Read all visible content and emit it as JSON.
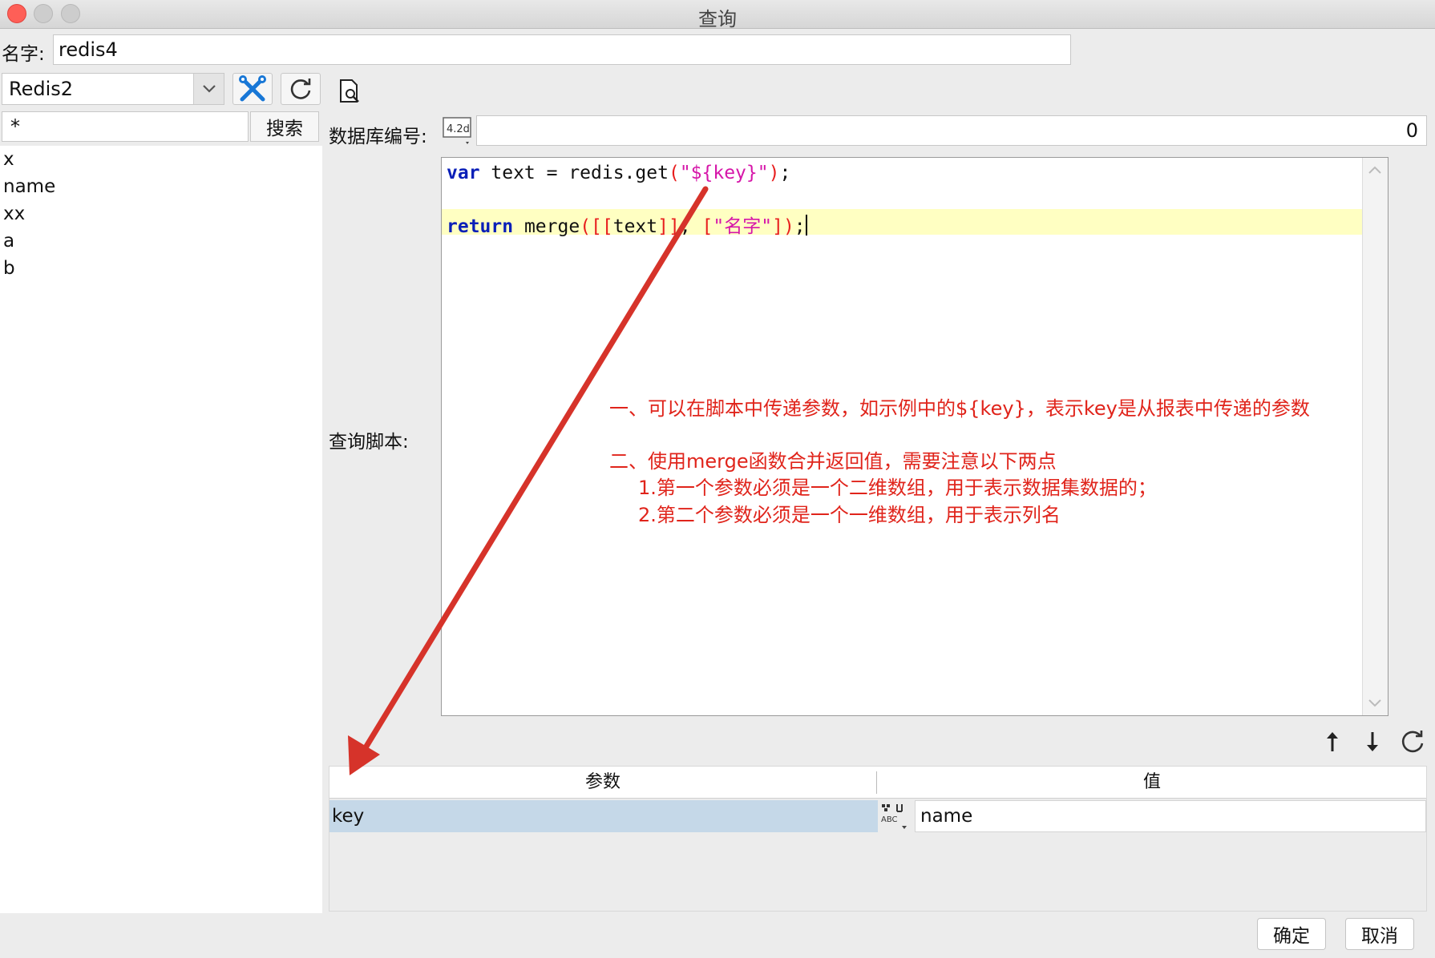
{
  "window": {
    "title": "查询",
    "traffic_lights": {
      "close": "#fe5f57",
      "minimize": "#cdcdcd",
      "maximize": "#cdcdcd"
    }
  },
  "name_row": {
    "label": "名字:",
    "value": "redis4"
  },
  "toolbar": {
    "datasource": "Redis2",
    "icons": [
      "dropdown-chevron-icon",
      "tools-icon",
      "refresh-icon",
      "preview-icon"
    ]
  },
  "search": {
    "value": "*",
    "button_label": "搜索"
  },
  "keys": [
    "x",
    "name",
    "xx",
    "a",
    "b"
  ],
  "db_number": {
    "label": "数据库编号:",
    "value": "0",
    "icon": "number-type-icon"
  },
  "script": {
    "label": "查询脚本:",
    "line1": {
      "kw": "var",
      "pre": " text = redis.get",
      "paren_open": "(",
      "string": "\"${key}\"",
      "paren_close": ")",
      "end": ";"
    },
    "line2": {
      "kw": "return",
      "pre": " merge",
      "open": "([[",
      "text": "text",
      "close": "]]",
      "comma": ", ",
      "lb": "[",
      "string": "\"名字\"",
      "rb": "])",
      "end": ";"
    }
  },
  "annotations": {
    "color": "#e0241b",
    "note1": "一、可以在脚本中传递参数，如示例中的${key}，表示key是从报表中传递的参数",
    "note2": "二、使用merge函数合并返回值，需要注意以下两点",
    "note2_1": "1.第一个参数必须是一个二维数组，用于表示数据集数据的；",
    "note2_2": "2.第二个参数必须是一个一维数组，用于表示列名"
  },
  "params": {
    "headers": {
      "param": "参数",
      "value": "值"
    },
    "rows": [
      {
        "param": "key",
        "value": "name",
        "type_icon": "abc-type-icon"
      }
    ],
    "actions": [
      "move-up-icon",
      "move-down-icon",
      "refresh-icon"
    ]
  },
  "footer": {
    "ok_label": "确定",
    "cancel_label": "取消"
  }
}
